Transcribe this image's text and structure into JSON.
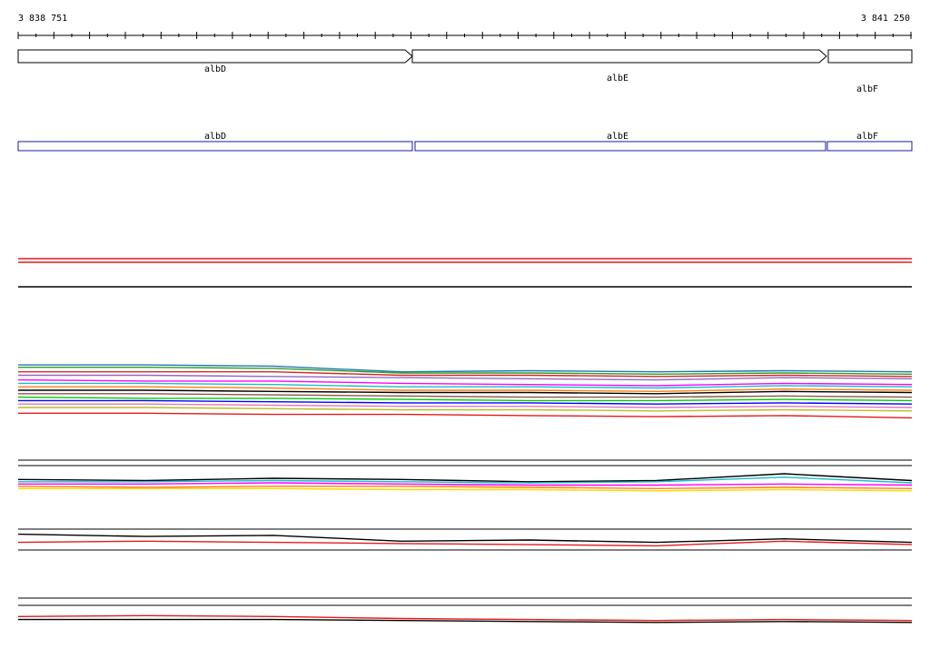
{
  "chart_data": {
    "type": "line",
    "coords": {
      "start": "3 838 751",
      "end": "3 841 250",
      "start_value": 3838751,
      "end_value": 3841250
    },
    "genes": [
      {
        "name": "albD",
        "start": 3838751,
        "end": 3839858,
        "strand": "+"
      },
      {
        "name": "albE",
        "start": 3839858,
        "end": 3841021,
        "strand": "+"
      },
      {
        "name": "albF",
        "start": 3841021,
        "end": 3841250,
        "strand": "+"
      }
    ],
    "tracks": [
      {
        "track": "reference-red-pair",
        "series": [
          {
            "color": "#e41a1c",
            "values": [
              0.2,
              0.2
            ]
          },
          {
            "color": "#e41a1c",
            "values": [
              0.0,
              0.0
            ]
          }
        ]
      },
      {
        "track": "baseline",
        "series": [
          {
            "color": "#000000",
            "values": [
              0.0,
              0.0
            ]
          }
        ]
      },
      {
        "track": "multi-condition-expression",
        "series": [
          {
            "color": "#1f77b4",
            "values": [
              9.2,
              9.2,
              9.1,
              8.6,
              8.7,
              8.6,
              8.7,
              8.6
            ]
          },
          {
            "color": "#2ca02c",
            "values": [
              9.0,
              9.0,
              8.9,
              8.5,
              8.5,
              8.4,
              8.5,
              8.4
            ]
          },
          {
            "color": "#d62728",
            "values": [
              8.6,
              8.6,
              8.6,
              8.3,
              8.3,
              8.2,
              8.3,
              8.2
            ]
          },
          {
            "color": "#9467bd",
            "values": [
              8.3,
              8.3,
              8.2,
              8.1,
              8.0,
              7.9,
              8.1,
              8.0
            ]
          },
          {
            "color": "#ff00ff",
            "values": [
              7.9,
              7.8,
              7.8,
              7.6,
              7.5,
              7.4,
              7.6,
              7.5
            ]
          },
          {
            "color": "#17becf",
            "values": [
              7.6,
              7.6,
              7.5,
              7.3,
              7.3,
              7.2,
              7.4,
              7.3
            ]
          },
          {
            "color": "#ff7f0e",
            "values": [
              7.3,
              7.3,
              7.2,
              7.0,
              7.0,
              6.9,
              7.1,
              7.0
            ]
          },
          {
            "color": "#000000",
            "values": [
              7.0,
              7.0,
              6.9,
              6.8,
              6.8,
              6.7,
              6.9,
              6.8
            ]
          },
          {
            "color": "#8c564b",
            "values": [
              6.7,
              6.7,
              6.6,
              6.5,
              6.4,
              6.4,
              6.5,
              6.4
            ]
          },
          {
            "color": "#00cc00",
            "values": [
              6.4,
              6.3,
              6.3,
              6.2,
              6.1,
              6.1,
              6.2,
              6.1
            ]
          },
          {
            "color": "#0000ff",
            "values": [
              6.1,
              6.1,
              6.0,
              5.9,
              5.9,
              5.8,
              5.9,
              5.8
            ]
          },
          {
            "color": "#e377c2",
            "values": [
              5.8,
              5.8,
              5.7,
              5.6,
              5.6,
              5.5,
              5.6,
              5.5
            ]
          },
          {
            "color": "#bcbd22",
            "values": [
              5.5,
              5.5,
              5.4,
              5.3,
              5.3,
              5.2,
              5.3,
              5.2
            ]
          },
          {
            "color": "#e41a1c",
            "values": [
              5.0,
              5.0,
              4.9,
              4.9,
              4.8,
              4.7,
              4.8,
              4.6
            ]
          }
        ]
      },
      {
        "track": "condition-set-2",
        "series": [
          {
            "color": "#000000",
            "values": [
              4.1,
              4.0,
              4.2,
              4.1,
              3.9,
              4.0,
              4.6,
              4.0
            ]
          },
          {
            "color": "#17becf",
            "values": [
              3.9,
              3.9,
              4.0,
              3.9,
              3.8,
              3.9,
              4.3,
              3.8
            ]
          },
          {
            "color": "#ff00ff",
            "values": [
              3.7,
              3.7,
              3.8,
              3.7,
              3.6,
              3.6,
              3.7,
              3.6
            ]
          },
          {
            "color": "#ff7f0e",
            "values": [
              3.5,
              3.4,
              3.5,
              3.5,
              3.4,
              3.3,
              3.4,
              3.3
            ]
          },
          {
            "color": "#ffd700",
            "values": [
              3.3,
              3.3,
              3.3,
              3.2,
              3.2,
              3.1,
              3.2,
              3.1
            ]
          }
        ]
      },
      {
        "track": "red-black-pair-1",
        "series": [
          {
            "color": "#000000",
            "values": [
              5.0,
              4.8,
              4.9,
              4.4,
              4.5,
              4.3,
              4.6,
              4.3
            ]
          },
          {
            "color": "#e41a1c",
            "values": [
              4.3,
              4.4,
              4.3,
              4.2,
              4.1,
              4.0,
              4.4,
              4.1
            ]
          }
        ]
      },
      {
        "track": "red-black-pair-2",
        "series": [
          {
            "color": "#e41a1c",
            "values": [
              4.9,
              5.0,
              4.9,
              4.7,
              4.6,
              4.5,
              4.6,
              4.5
            ]
          },
          {
            "color": "#000000",
            "values": [
              4.6,
              4.6,
              4.6,
              4.5,
              4.4,
              4.3,
              4.4,
              4.3
            ]
          }
        ]
      }
    ]
  }
}
